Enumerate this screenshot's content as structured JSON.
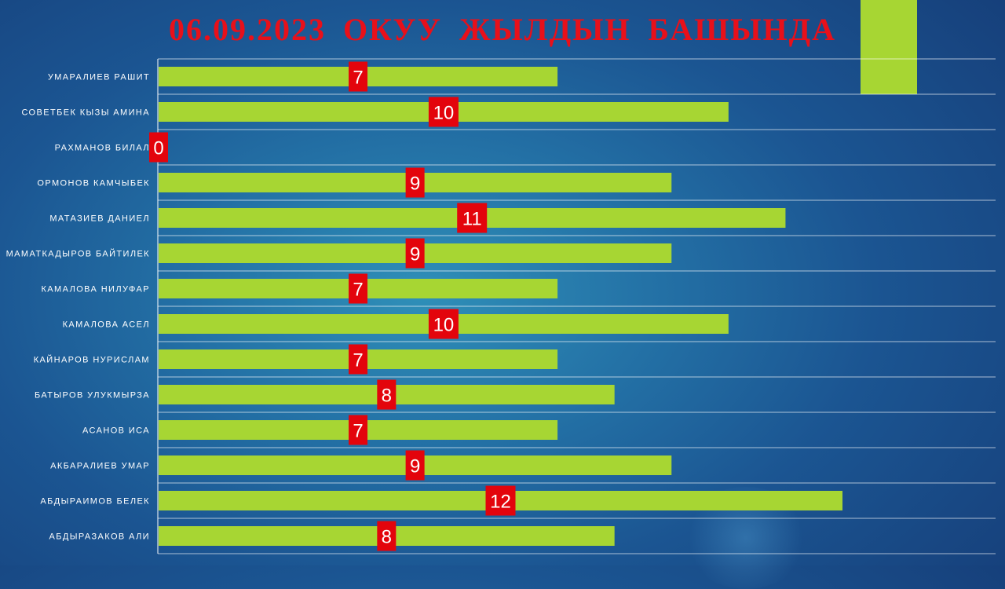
{
  "title": "06.09.2023  ОКУУ  ЖЫЛДЫН  БАШЫНДА",
  "colors": {
    "bar": "#a7d633",
    "label_box": "#e3040c",
    "label_text": "#ffffff",
    "title": "#e8101a",
    "grid": "#ffffff"
  },
  "chart_data": {
    "type": "bar",
    "orientation": "horizontal",
    "title": "06.09.2023  ОКУУ  ЖЫЛДЫН  БАШЫНДА",
    "categories": [
      "УМАРАЛИЕВ РАШИТ",
      "СОВЕТБЕК КЫЗЫ АМИНА",
      "РАХМАНОВ БИЛАЛ",
      "ОРМОНОВ КАМЧЫБЕК",
      "МАТАЗИЕВ ДАНИЕЛ",
      "МАМАТКАДЫРОВ БАЙТИЛЕК",
      "КАМАЛОВА НИЛУФАР",
      "КАМАЛОВА АСЕЛ",
      "КАЙНАРОВ НУРИСЛАМ",
      "БАТЫРОВ УЛУКМЫРЗА",
      "АСАНОВ ИСА",
      "АКБАРАЛИЕВ УМАР",
      "АБДЫРАИМОВ БЕЛЕК",
      "АБДЫРАЗАКОВ АЛИ"
    ],
    "values": [
      7,
      10,
      0,
      9,
      11,
      9,
      7,
      10,
      7,
      8,
      7,
      9,
      12,
      8
    ],
    "data_labels": [
      "7",
      "10",
      "0",
      "9",
      "11",
      "9",
      "7",
      "10",
      "7",
      "8",
      "7",
      "9",
      "12",
      "8"
    ],
    "xlabel": "",
    "ylabel": "",
    "xlim": [
      0,
      14.7
    ],
    "grid": "horizontal lines between categories",
    "legend": "none"
  }
}
